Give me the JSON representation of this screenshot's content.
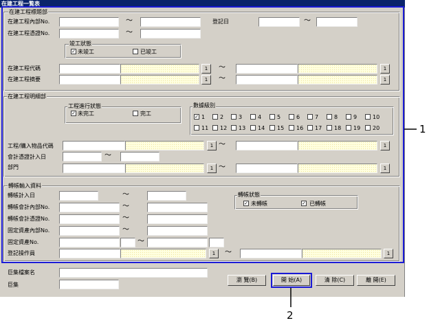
{
  "window": {
    "title": "在建工程一覧表"
  },
  "header": {
    "section_label": "在建工程標題部",
    "internal_no_label": "在建工程內部No.",
    "voucher_no_label": "在建工程憑證No.",
    "register_date_label": "登記日",
    "completion_status_label": "竣工狀態",
    "not_completed_label": "未竣工",
    "completed_label": "已竣工",
    "not_completed_checked": true,
    "completed_checked": false,
    "code_label": "在建工程代碼",
    "summary_label": "在建工程摘要"
  },
  "detail": {
    "section_label": "在建工程明細部",
    "progress_status_label": "工程進行狀態",
    "not_done_label": "未完工",
    "done_label": "完工",
    "not_done_checked": true,
    "done_checked": false,
    "level_group_label": "數據級別",
    "levels": [
      "1",
      "2",
      "3",
      "4",
      "5",
      "6",
      "7",
      "8",
      "9",
      "10",
      "11",
      "12",
      "13",
      "14",
      "15",
      "16",
      "17",
      "18",
      "19",
      "20"
    ],
    "level_checked": [
      true,
      false,
      false,
      false,
      false,
      false,
      false,
      false,
      false,
      false,
      false,
      false,
      false,
      false,
      false,
      false,
      false,
      false,
      false,
      false
    ],
    "item_code_label": "工程/購入物品代碼",
    "voucher_date_label": "會計憑證計入日",
    "dept_label": "部門"
  },
  "transfer": {
    "section_label": "轉帳輸入資料",
    "transfer_date_label": "轉帳計入日",
    "acct_internal_label": "轉帳會計內部No.",
    "acct_voucher_label": "轉帳會計憑證No.",
    "asset_internal_label": "固定資產內部No.",
    "asset_no_label": "固定資產No.",
    "operator_label": "登記操作員",
    "status_label": "轉帳狀態",
    "not_transferred_label": "未轉帳",
    "transferred_label": "已轉帳",
    "not_transferred_checked": true,
    "transferred_checked": true
  },
  "footer": {
    "macro_file_label": "巨集檔案名",
    "macro_label": "巨集"
  },
  "buttons": {
    "browse": "瀏 覽(B)",
    "start": "開 始(A)",
    "clear": "清 除(C)",
    "exit": "離 開(E)",
    "lookup": "1"
  },
  "symbols": {
    "tilde": "～",
    "check": "✓"
  },
  "callouts": {
    "one": "1",
    "two": "2"
  },
  "colors": {
    "frame_highlight": "#1a1ad6",
    "titlebar": "#0a246a",
    "yellow_field": "#ffffe0"
  }
}
